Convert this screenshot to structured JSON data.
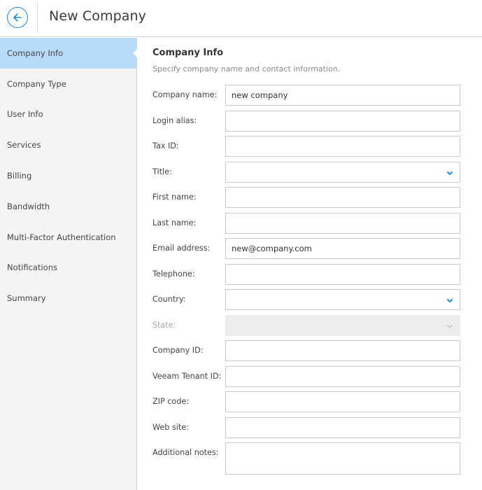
{
  "header": {
    "title": "New Company",
    "back_icon": "arrow-left-circle-icon"
  },
  "colors": {
    "accent": "#1e8ad6",
    "active_nav_bg": "#b8dcf8",
    "sidebar_bg": "#f4f4f4",
    "disabled_bg": "#ececec"
  },
  "sidebar": {
    "items": [
      {
        "label": "Company Info",
        "active": true
      },
      {
        "label": "Company Type",
        "active": false
      },
      {
        "label": "User Info",
        "active": false
      },
      {
        "label": "Services",
        "active": false
      },
      {
        "label": "Billing",
        "active": false
      },
      {
        "label": "Bandwidth",
        "active": false
      },
      {
        "label": "Multi-Factor Authentication",
        "active": false
      },
      {
        "label": "Notifications",
        "active": false
      },
      {
        "label": "Summary",
        "active": false
      }
    ]
  },
  "main": {
    "title": "Company Info",
    "description": "Specify company name and contact information.",
    "fields": [
      {
        "label": "Company name:",
        "value": "new company",
        "type": "text"
      },
      {
        "label": "Login alias:",
        "value": "",
        "type": "text"
      },
      {
        "label": "Tax ID:",
        "value": "",
        "type": "text"
      },
      {
        "label": "Title:",
        "value": "",
        "type": "select"
      },
      {
        "label": "First name:",
        "value": "",
        "type": "text"
      },
      {
        "label": "Last name:",
        "value": "",
        "type": "text"
      },
      {
        "label": "Email address:",
        "value": "new@company.com",
        "type": "text"
      },
      {
        "label": "Telephone:",
        "value": "",
        "type": "text"
      },
      {
        "label": "Country:",
        "value": "",
        "type": "select"
      },
      {
        "label": "State:",
        "value": "",
        "type": "select",
        "disabled": true
      },
      {
        "label": "Company ID:",
        "value": "",
        "type": "text"
      },
      {
        "label": "Veeam Tenant ID:",
        "value": "",
        "type": "text"
      },
      {
        "label": "ZIP code:",
        "value": "",
        "type": "text"
      },
      {
        "label": "Web site:",
        "value": "",
        "type": "text"
      },
      {
        "label": "Additional notes:",
        "value": "",
        "type": "textarea"
      }
    ]
  }
}
